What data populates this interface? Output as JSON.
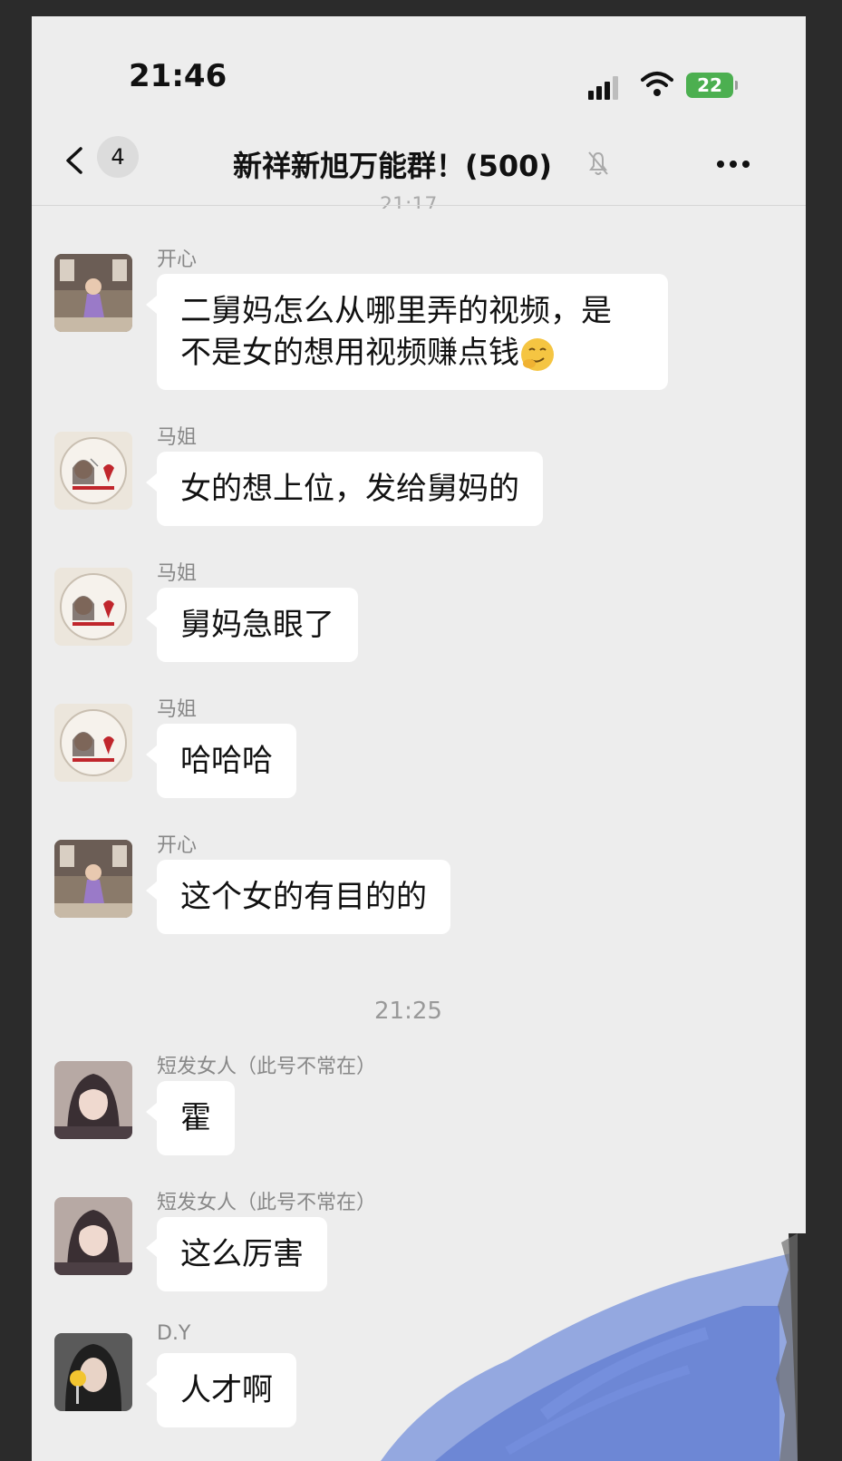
{
  "status_bar": {
    "time": "21:46",
    "battery": "22"
  },
  "nav": {
    "unread_count": "4",
    "title": "新祥新旭万能群！(500)",
    "partial_time": "21:17"
  },
  "icons": {
    "back": "chevron-left-icon",
    "mute": "bell-slash-icon",
    "more": "more-dots-icon",
    "emoji": "smirk-emoji-icon"
  },
  "messages": [
    {
      "sender": "开心",
      "text": "二舅妈怎么从哪里弄的视频，是",
      "text2": "不是女的想用视频赚点钱"
    },
    {
      "sender": "马姐",
      "text": "女的想上位，发给舅妈的"
    },
    {
      "sender": "马姐",
      "text": "舅妈急眼了"
    },
    {
      "sender": "马姐",
      "text": "哈哈哈"
    },
    {
      "sender": "开心",
      "text": "这个女的有目的的"
    },
    {
      "sender": "短发女人（此号不常在）",
      "text": "霍"
    },
    {
      "sender": "短发女人（此号不常在）",
      "text": "这么厉害"
    },
    {
      "sender": "D.Y",
      "text": "人才啊"
    }
  ],
  "timestamp": "21:25",
  "colors": {
    "background": "#ededed",
    "bubble": "#ffffff",
    "battery": "#4caf50",
    "brush": "#4a6fd6"
  }
}
